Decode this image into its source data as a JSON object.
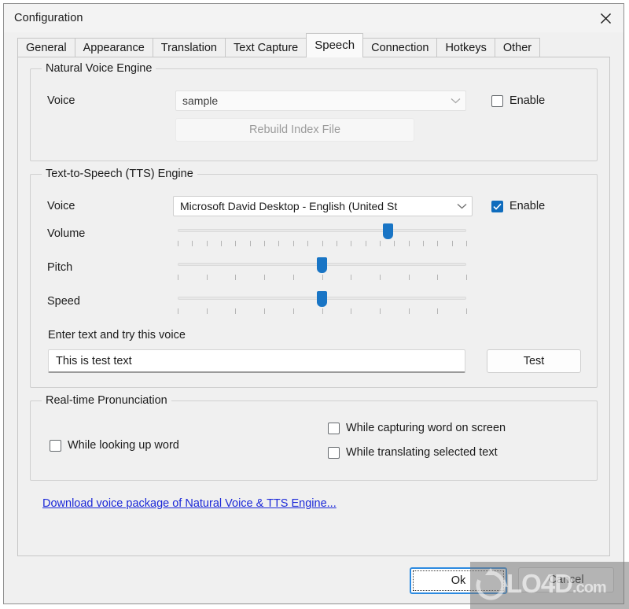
{
  "window": {
    "title": "Configuration",
    "close_icon": "close-icon"
  },
  "tabs": [
    {
      "label": "General",
      "active": false
    },
    {
      "label": "Appearance",
      "active": false
    },
    {
      "label": "Translation",
      "active": false
    },
    {
      "label": "Text Capture",
      "active": false
    },
    {
      "label": "Speech",
      "active": true
    },
    {
      "label": "Connection",
      "active": false
    },
    {
      "label": "Hotkeys",
      "active": false
    },
    {
      "label": "Other",
      "active": false
    }
  ],
  "natural_voice": {
    "legend": "Natural Voice Engine",
    "voice_label": "Voice",
    "voice_value": "sample",
    "rebuild_label": "Rebuild Index File",
    "enable_label": "Enable",
    "enable_checked": false
  },
  "tts": {
    "legend": "Text-to-Speech (TTS) Engine",
    "voice_label": "Voice",
    "voice_value": "Microsoft David Desktop - English (United St",
    "enable_label": "Enable",
    "enable_checked": true,
    "sliders": [
      {
        "label": "Volume",
        "value": 73,
        "ticks": 21
      },
      {
        "label": "Pitch",
        "value": 50,
        "ticks": 11
      },
      {
        "label": "Speed",
        "value": 50,
        "ticks": 11
      }
    ],
    "try_label": "Enter text and try this voice",
    "test_text": "This is test text",
    "test_placeholder": "Enter text and try this voice",
    "test_button": "Test"
  },
  "realtime": {
    "legend": "Real-time Pronunciation",
    "options": [
      {
        "label": "While looking up word",
        "checked": false
      },
      {
        "label": "While capturing word on screen",
        "checked": false
      },
      {
        "label": "While translating selected text",
        "checked": false
      }
    ]
  },
  "download_link": "Download voice package of Natural Voice & TTS Engine...",
  "footer": {
    "ok_label": "Ok",
    "cancel_label": "Cancel"
  },
  "watermark": {
    "text": "LO4D",
    "suffix": ".com"
  },
  "colors": {
    "accent": "#1975c5",
    "checkbox_checked": "#0f6cbd",
    "link": "#1b28d8",
    "focus_border": "#2c8ae0",
    "dialog_bg": "#f0f0f0"
  }
}
